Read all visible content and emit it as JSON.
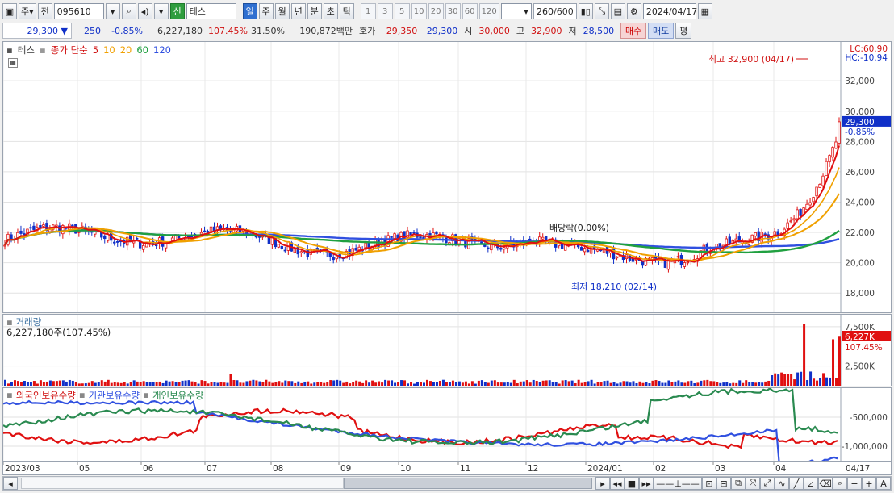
{
  "toolbar": {
    "market": "주",
    "prev": "전",
    "code": "095610",
    "credit_badge": "신",
    "name": "테스",
    "periods": [
      "일",
      "주",
      "월",
      "년",
      "분",
      "초",
      "틱"
    ],
    "active_period": "일",
    "intervals": [
      "1",
      "3",
      "5",
      "10",
      "20",
      "30",
      "60",
      "120"
    ],
    "count": "260",
    "count_total": "/600",
    "date": "2024/04/17"
  },
  "info": {
    "price": "29,300",
    "change": "250",
    "change_pct": "-0.85%",
    "volume": "6,227,180",
    "vol_ratio": "107.45%",
    "turnover": "31.50%",
    "amount": "190,872백만",
    "ask_label": "호가",
    "ask": "29,350",
    "bid": "29,300",
    "open_label": "시",
    "open": "30,000",
    "high_label": "고",
    "high": "32,900",
    "low_label": "저",
    "low": "28,500",
    "buy": "매수",
    "sell": "매도",
    "avg": "평"
  },
  "price_panel": {
    "legend_name": "테스",
    "legend_type": "종가 단순",
    "ma_periods": [
      "5",
      "10",
      "20",
      "60",
      "120"
    ],
    "ma_colors": [
      "#e01010",
      "#f0a000",
      "#f0a000",
      "#20a040",
      "#3050e0"
    ],
    "lc": "LC:60.90",
    "hc": "HC:-10.94",
    "y_ticks": [
      "32,000",
      "30,000",
      "28,000",
      "26,000",
      "24,000",
      "22,000",
      "20,000",
      "18,000"
    ],
    "last_price": "29,300",
    "last_pct": "-0.85%",
    "high_note": "최고 32,900 (04/17)",
    "low_note": "최저 18,210 (02/14)",
    "dividend_note": "배당락(0.00%)"
  },
  "volume_panel": {
    "title": "거래량",
    "summary": "6,227,180주(107.45%)",
    "y_ticks": [
      "7,500K",
      "2,500K"
    ],
    "last_value": "6,227K",
    "last_pct": "107.45%"
  },
  "holding_panel": {
    "series": [
      {
        "name": "외국인보유수량",
        "color": "#e01010"
      },
      {
        "name": "기관보유수량",
        "color": "#3050e0"
      },
      {
        "name": "개인보유수량",
        "color": "#2a8a50"
      }
    ],
    "y_ticks": [
      "-500,000",
      "-1,000,000"
    ]
  },
  "x_axis": {
    "labels": [
      "2023/03",
      "05",
      "06",
      "07",
      "08",
      "09",
      "10",
      "11",
      "12",
      "2024/01",
      "02",
      "03",
      "04"
    ],
    "last_label": "04/17"
  }
}
